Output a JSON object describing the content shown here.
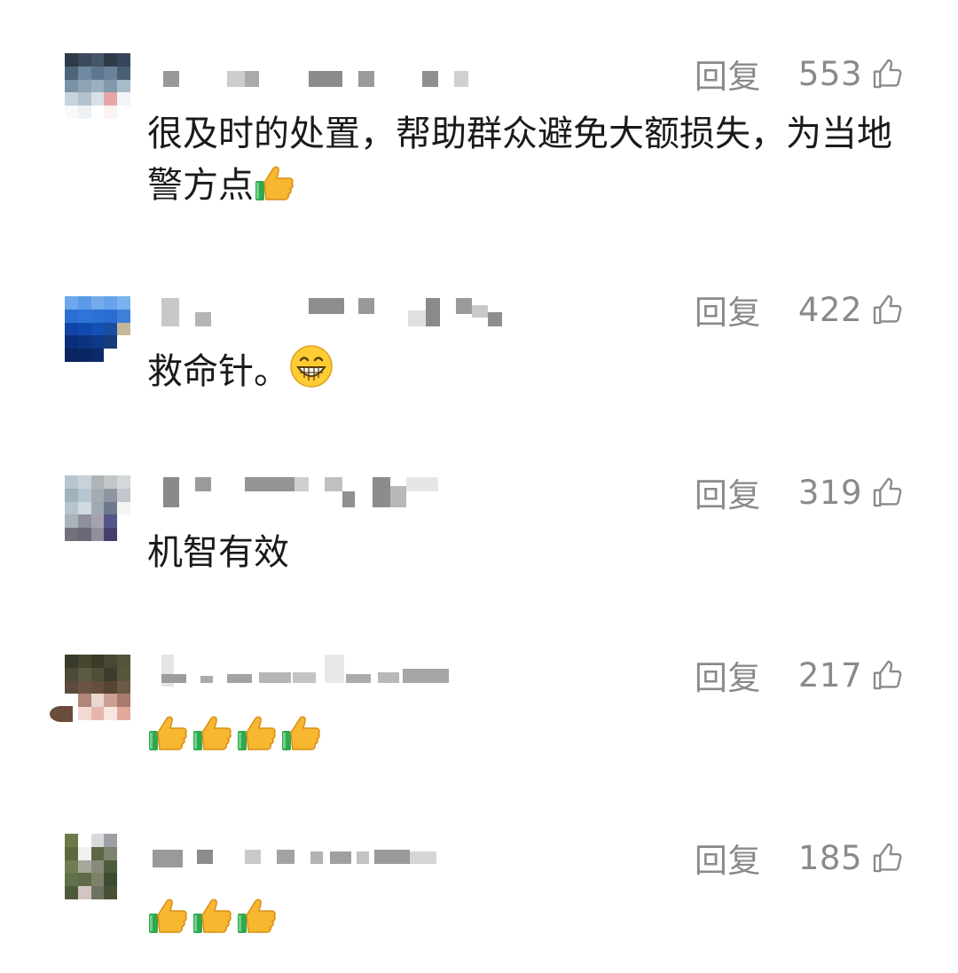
{
  "reply_label": "回复",
  "comments": [
    {
      "likes": "553",
      "text": "很及时的处置，帮助群众避免大额损失，为当地警方点",
      "emoji": [
        "thumbs-up"
      ]
    },
    {
      "likes": "422",
      "text": "救命针。",
      "emoji": [
        "grinning-face"
      ]
    },
    {
      "likes": "319",
      "text": "机智有效",
      "emoji": []
    },
    {
      "likes": "217",
      "text": "",
      "emoji": [
        "thumbs-up",
        "thumbs-up",
        "thumbs-up",
        "thumbs-up"
      ]
    },
    {
      "likes": "185",
      "text": "",
      "emoji": [
        "thumbs-up",
        "thumbs-up",
        "thumbs-up"
      ]
    }
  ],
  "colors": {
    "action_gray": "#8a8a8a",
    "text": "#1a1a1a",
    "emoji_yellow": "#f7b731",
    "emoji_green": "#2fa84f"
  },
  "icons": [
    "like-icon",
    "thumbs-up-emoji",
    "grinning-face-emoji"
  ]
}
